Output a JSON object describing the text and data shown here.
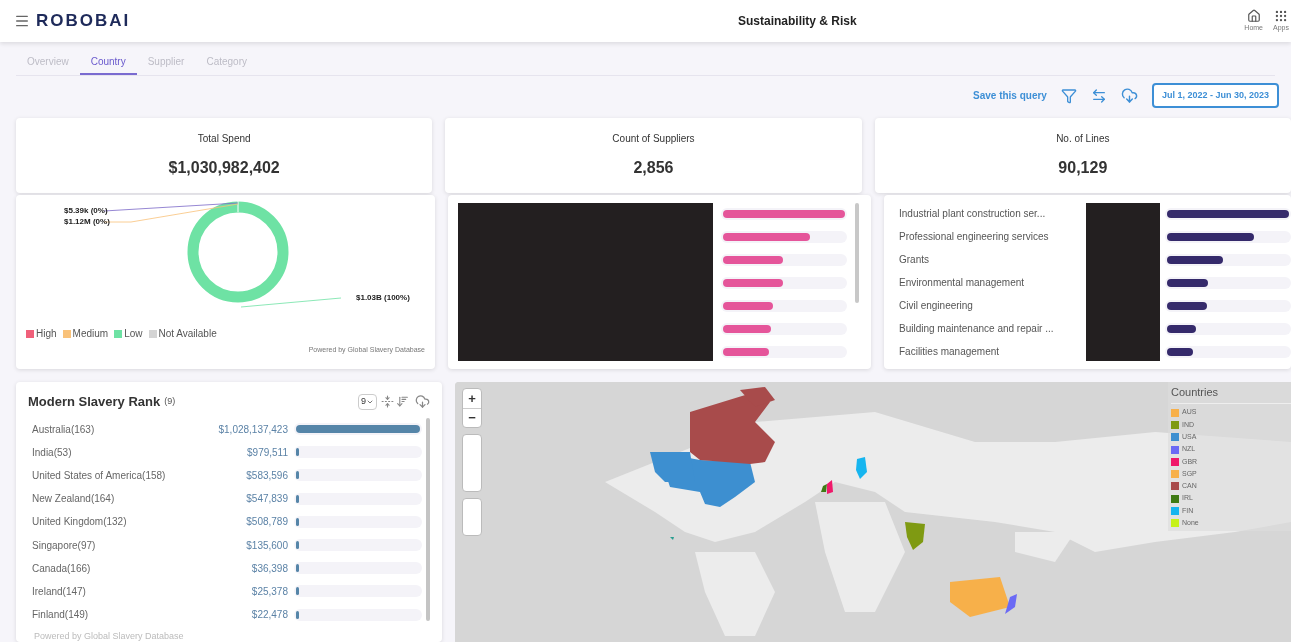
{
  "header": {
    "logo": "ROBOBAI",
    "title": "Sustainability & Risk",
    "nav": [
      {
        "kind": "home",
        "label": "Home"
      },
      {
        "kind": "apps",
        "label": "Apps"
      }
    ]
  },
  "tabs": [
    {
      "label": "Overview",
      "selected": false
    },
    {
      "label": "Country",
      "selected": true
    },
    {
      "label": "Supplier",
      "selected": false
    },
    {
      "label": "Category",
      "selected": false
    }
  ],
  "toolbar": {
    "save": "Save this query",
    "date_range": "Jul 1, 2022 - Jun 30, 2023"
  },
  "kpis": [
    {
      "label": "Total Spend",
      "value": "$1,030,982,402"
    },
    {
      "label": "Count of Suppliers",
      "value": "2,856"
    },
    {
      "label": "No. of Lines",
      "value": "90,129"
    }
  ],
  "risk_donut": {
    "value_labels": [
      "$5.39k (0%)",
      "$1.12M (0%)",
      "$1.03B (100%)"
    ],
    "legend": [
      {
        "label": "High",
        "color": "#f0607a"
      },
      {
        "label": "Medium",
        "color": "#f9c27a"
      },
      {
        "label": "Low",
        "color": "#6ee2a4"
      },
      {
        "label": "Not Available",
        "color": "#d4d4d4"
      }
    ],
    "footer": "Powered by Global Slavery Database"
  },
  "supplier_bars": [
    {
      "level": 1
    },
    {
      "level": 0.71
    },
    {
      "level": 0.49
    },
    {
      "level": 0.49
    },
    {
      "level": 0.41
    },
    {
      "level": 0.39
    },
    {
      "level": 0.38
    }
  ],
  "category_bars": [
    {
      "label": "Industrial plant construction ser...",
      "level": 1
    },
    {
      "label": "Professional engineering services",
      "level": 0.71
    },
    {
      "label": "Grants",
      "level": 0.46
    },
    {
      "label": "Environmental management",
      "level": 0.34
    },
    {
      "label": "Civil engineering",
      "level": 0.33
    },
    {
      "label": "Building maintenance and repair ...",
      "level": 0.24
    },
    {
      "label": "Facilities management",
      "level": 0.21
    }
  ],
  "rank": {
    "title": "Modern Slavery Rank",
    "count": "(9)",
    "page_size": "9",
    "rows": [
      {
        "country": "Australia(163)",
        "spend": "$1,028,137,423",
        "level": 1
      },
      {
        "country": "India(53)",
        "spend": "$979,511",
        "level": 0.012
      },
      {
        "country": "United States of America(158)",
        "spend": "$583,596",
        "level": 0.012
      },
      {
        "country": "New Zealand(164)",
        "spend": "$547,839",
        "level": 0.012
      },
      {
        "country": "United Kingdom(132)",
        "spend": "$508,789",
        "level": 0.012
      },
      {
        "country": "Singapore(97)",
        "spend": "$135,600",
        "level": 0.012
      },
      {
        "country": "Canada(166)",
        "spend": "$36,398",
        "level": 0.012
      },
      {
        "country": "Ireland(147)",
        "spend": "$25,378",
        "level": 0.012
      },
      {
        "country": "Finland(149)",
        "spend": "$22,478",
        "level": 0.012
      }
    ],
    "footer": "Powered by Global Slavery Database"
  },
  "map": {
    "zoom_in": "+",
    "zoom_out": "−",
    "legend_title": "Countries",
    "legend": [
      {
        "label": "AUS",
        "color": "#f7b04a"
      },
      {
        "label": "IND",
        "color": "#7f9a12"
      },
      {
        "label": "USA",
        "color": "#3d8fd0"
      },
      {
        "label": "NZL",
        "color": "#6b6af5"
      },
      {
        "label": "GBR",
        "color": "#f0186a"
      },
      {
        "label": "SGP",
        "color": "#f7b04a"
      },
      {
        "label": "CAN",
        "color": "#a84b4b"
      },
      {
        "label": "IRL",
        "color": "#3f7a14"
      },
      {
        "label": "FIN",
        "color": "#16b5ef"
      },
      {
        "label": "None",
        "color": "#c6f21a"
      }
    ]
  }
}
